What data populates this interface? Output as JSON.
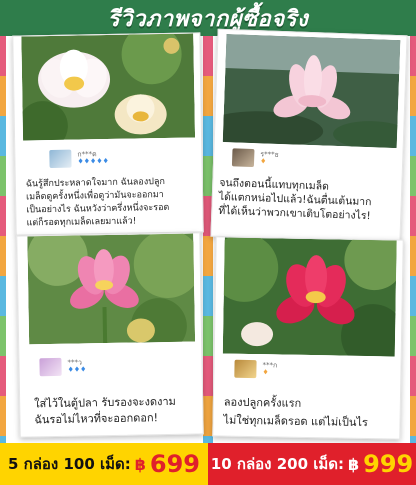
{
  "header": {
    "title": "รีวิวภาพจากผู้ซื้อจริง"
  },
  "colors": {
    "header_bg": "#2f7d4b",
    "price_left_bg": "#ffd400",
    "price_right_bg": "#e0202b",
    "star": "#3b8be5"
  },
  "reviews": [
    {
      "username": "ก***ด",
      "stars": "♦♦♦♦♦",
      "text_lines": [
        "ฉันรู้สึกประหลาดใจมาก ฉันลองปลูก",
        "เมล็ดดูครั้งหนึ่งเพื่อดูว่ามันจะออกมา",
        "เป็นอย่างไร ฉันหวังว่าครึ่งหนึ่งจะรอด",
        "แต่ก็รอดทุกเมล็ดเลยมาแล้ว!"
      ],
      "flower": "white-lotus-icon"
    },
    {
      "username": "ร***ธ",
      "stars": "♦",
      "text_lines": [
        "จนถึงตอนนี้แทบทุกเมล็ด",
        "ได้แตกหน่อไปแล้ว!ฉันตื่นเต้นมาก",
        "ที่ได้เห็นว่าพวกเขาเติบโตอย่างไร!"
      ],
      "flower": "pink-lotus-icon"
    },
    {
      "username": "***ว",
      "stars": "♦♦♦",
      "text_lines": [
        "ใส่ไว้ในตู้ปลา รับรองจะงดงาม",
        "ฉันรอไม่ไหวที่จะออกดอก!"
      ],
      "flower": "pink-lotus-icon"
    },
    {
      "username": "***ก",
      "stars": "♦",
      "text_lines": [
        "ลองปลูกครั้งแรก",
        "ไม่ใช่ทุกเมล็ดรอด แต่ไม่เป็นไร"
      ],
      "flower": "red-lotus-icon"
    }
  ],
  "pricing": [
    {
      "label": "5 กล่อง 100 เม็ด:",
      "currency": "฿",
      "amount": "699"
    },
    {
      "label": "10 กล่อง 200 เม็ด:",
      "currency": "฿",
      "amount": "999"
    }
  ]
}
